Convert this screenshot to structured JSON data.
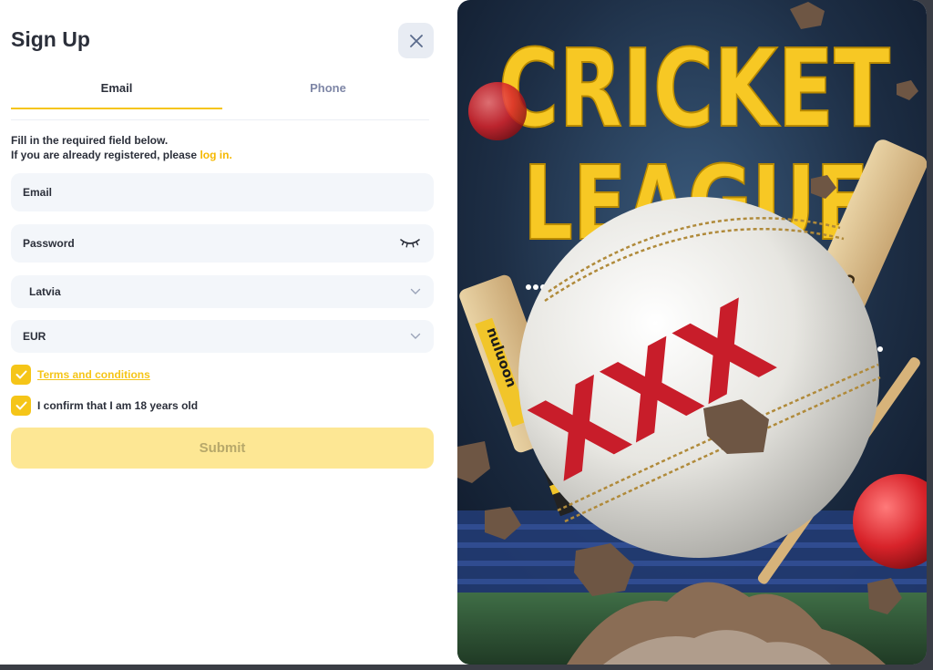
{
  "modal": {
    "title": "Sign Up",
    "close_icon": "close-icon"
  },
  "tabs": [
    {
      "label": "Email",
      "active": true
    },
    {
      "label": "Phone",
      "active": false
    }
  ],
  "hint": {
    "line1": "Fill in the required field below.",
    "line2": "If you are already registered, please",
    "login_link": "log in."
  },
  "fields": {
    "email_placeholder": "Email",
    "password_placeholder": "Password",
    "country_value": "Latvia",
    "currency_value": "EUR"
  },
  "checkboxes": {
    "terms_label": "Terms and conditions",
    "terms_checked": true,
    "age_label": "I confirm that I am 18 years old",
    "age_checked": true
  },
  "submit_label": "Submit",
  "banner": {
    "headline_1": "CRICKET",
    "headline_2": "LEAGUE",
    "ball_logo": "XXX",
    "bat_text_left": "nuluoon",
    "bat_text_right": "Graydon"
  },
  "colors": {
    "accent": "#f5c518",
    "submit_bg": "#fde794",
    "field_bg": "#f3f6fa",
    "tab_inactive": "#7e86a6"
  }
}
